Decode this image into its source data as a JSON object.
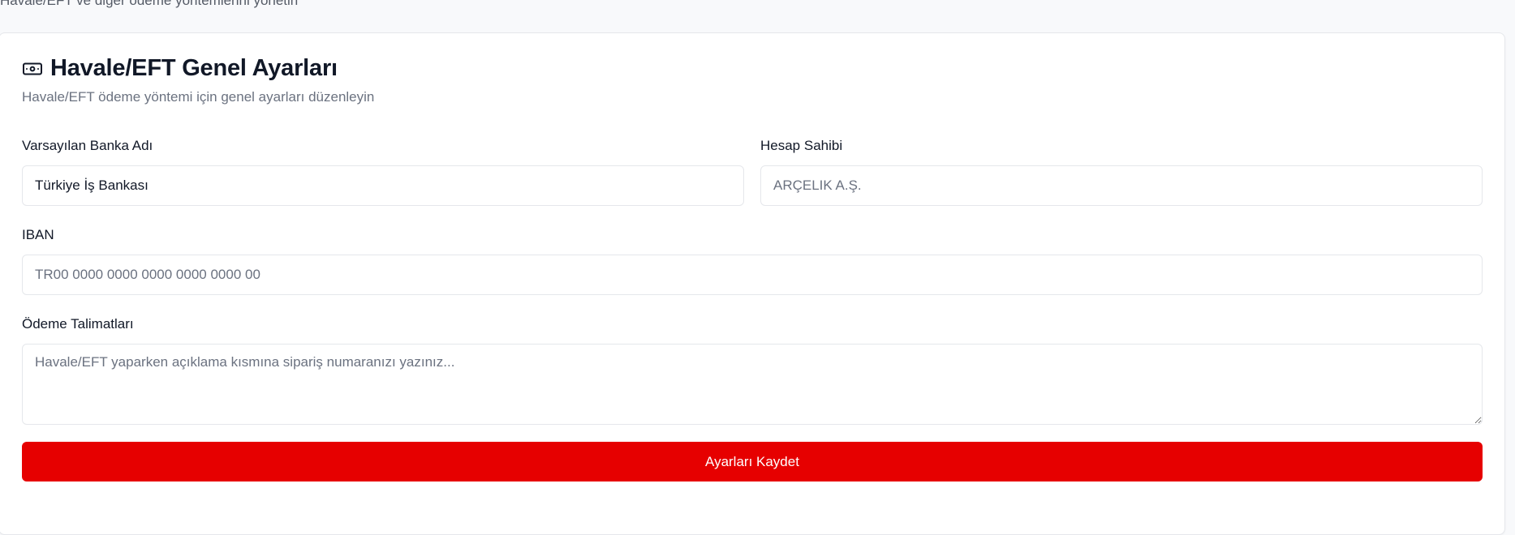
{
  "page": {
    "top_text": "Havale/EFT ve diğer ödeme yöntemlerini yönetin"
  },
  "card": {
    "title_icon": "banknote-icon",
    "title": "Havale/EFT Genel Ayarları",
    "subtitle": "Havale/EFT ödeme yöntemi için genel ayarları düzenleyin"
  },
  "form": {
    "bank_name": {
      "label": "Varsayılan Banka Adı",
      "value": "Türkiye İş Bankası",
      "placeholder": ""
    },
    "account_holder": {
      "label": "Hesap Sahibi",
      "value": "",
      "placeholder": "ARÇELIK A.Ş."
    },
    "iban": {
      "label": "IBAN",
      "value": "",
      "placeholder": "TR00 0000 0000 0000 0000 0000 00"
    },
    "payment_instructions": {
      "label": "Ödeme Talimatları",
      "value": "",
      "placeholder": "Havale/EFT yaparken açıklama kısmına sipariş numaranızı yazınız..."
    }
  },
  "actions": {
    "save_label": "Ayarları Kaydet"
  },
  "colors": {
    "accent": "#e60000",
    "background": "#f8f9fb",
    "border": "#e5e7eb",
    "muted_text": "#6b7280"
  }
}
